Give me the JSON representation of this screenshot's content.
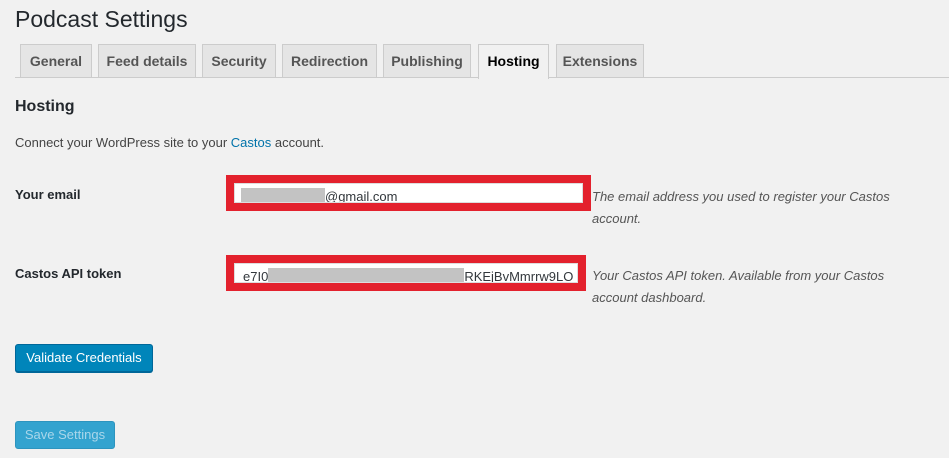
{
  "page": {
    "title": "Podcast Settings"
  },
  "tabs": [
    {
      "label": "General"
    },
    {
      "label": "Feed details"
    },
    {
      "label": "Security"
    },
    {
      "label": "Redirection"
    },
    {
      "label": "Publishing"
    },
    {
      "label": "Hosting",
      "active": true
    },
    {
      "label": "Extensions"
    }
  ],
  "section": {
    "title": "Hosting",
    "intro_before": "Connect your WordPress site to your ",
    "intro_link": "Castos",
    "intro_after": " account."
  },
  "fields": {
    "email": {
      "label": "Your email",
      "value_visible": "@gmail.com",
      "description": "The email address you used to register your Castos account."
    },
    "api_token": {
      "label": "Castos API token",
      "value_prefix": "e7I0",
      "value_suffix": "RKEjBvMmrrw9LO",
      "description": "Your Castos API token. Available from your Castos account dashboard."
    }
  },
  "buttons": {
    "validate": "Validate Credentials",
    "save": "Save Settings"
  },
  "colors": {
    "highlight_border": "#e3212d",
    "primary_button": "#0085ba",
    "link": "#0073aa",
    "background": "#f1f1f1"
  }
}
